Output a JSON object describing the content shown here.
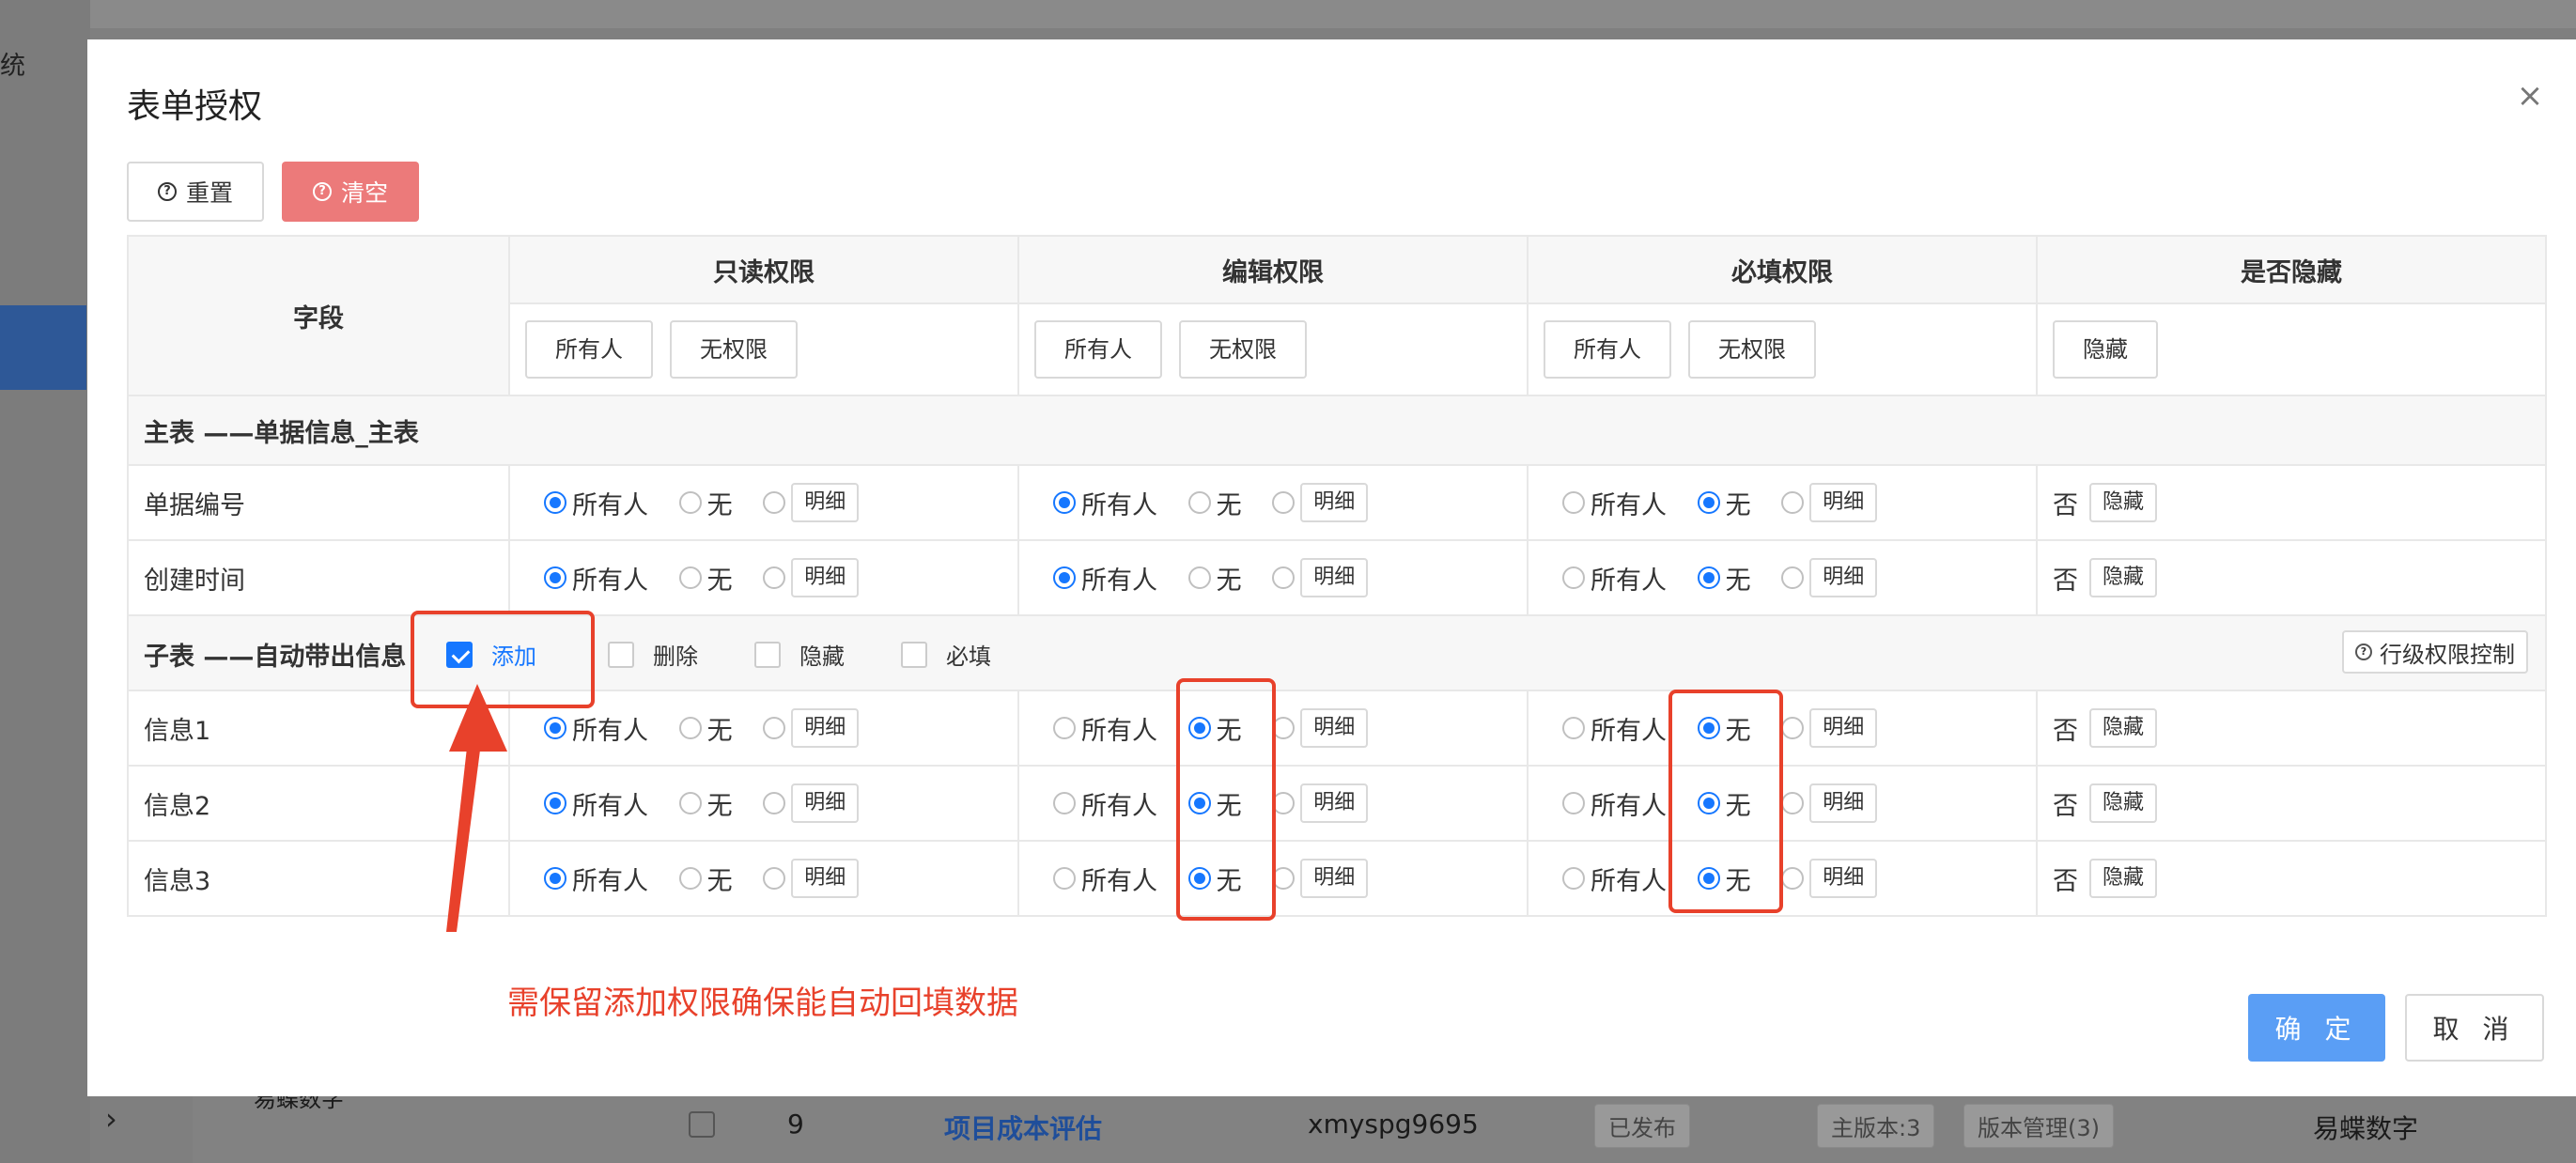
{
  "background": {
    "sidebar_label": "统",
    "row": {
      "index": "9",
      "name": "项目成本评估",
      "code": "xmyspg9695",
      "status": "已发布",
      "version": "主版本:3",
      "version_mgmt": "版本管理(3)",
      "company": "易蝶数字",
      "left_text": "易蝶数字"
    }
  },
  "modal": {
    "title": "表单授权",
    "close_icon": "×",
    "reset_label": "重置",
    "clear_label": "清空",
    "table": {
      "field_header": "字段",
      "col_readonly": "只读权限",
      "col_edit": "编辑权限",
      "col_required": "必填权限",
      "col_hidden": "是否隐藏",
      "btn_all": "所有人",
      "btn_none": "无权限",
      "btn_hide": "隐藏",
      "main_section": "主表 ——单据信息_主表",
      "sub_section": "子表 ——自动带出信息",
      "sub_add": "添加",
      "sub_delete": "删除",
      "sub_hide": "隐藏",
      "sub_required": "必填",
      "row_level_btn": "行级权限控制",
      "opt_all": "所有人",
      "opt_none": "无",
      "opt_detail": "明细",
      "hidden_no": "否",
      "hidden_btn": "隐藏",
      "rows": [
        {
          "name": "单据编号",
          "readonly": "all",
          "edit": "all",
          "required": "none"
        },
        {
          "name": "创建时间",
          "readonly": "all",
          "edit": "all",
          "required": "none"
        },
        {
          "name": "信息1",
          "readonly": "all",
          "edit": "none",
          "required": "none"
        },
        {
          "name": "信息2",
          "readonly": "all",
          "edit": "none",
          "required": "none"
        },
        {
          "name": "信息3",
          "readonly": "all",
          "edit": "none",
          "required": "none"
        }
      ]
    },
    "annotation": "需保留添加权限确保能自动回填数据",
    "ok_label": "确 定",
    "cancel_label": "取 消"
  }
}
